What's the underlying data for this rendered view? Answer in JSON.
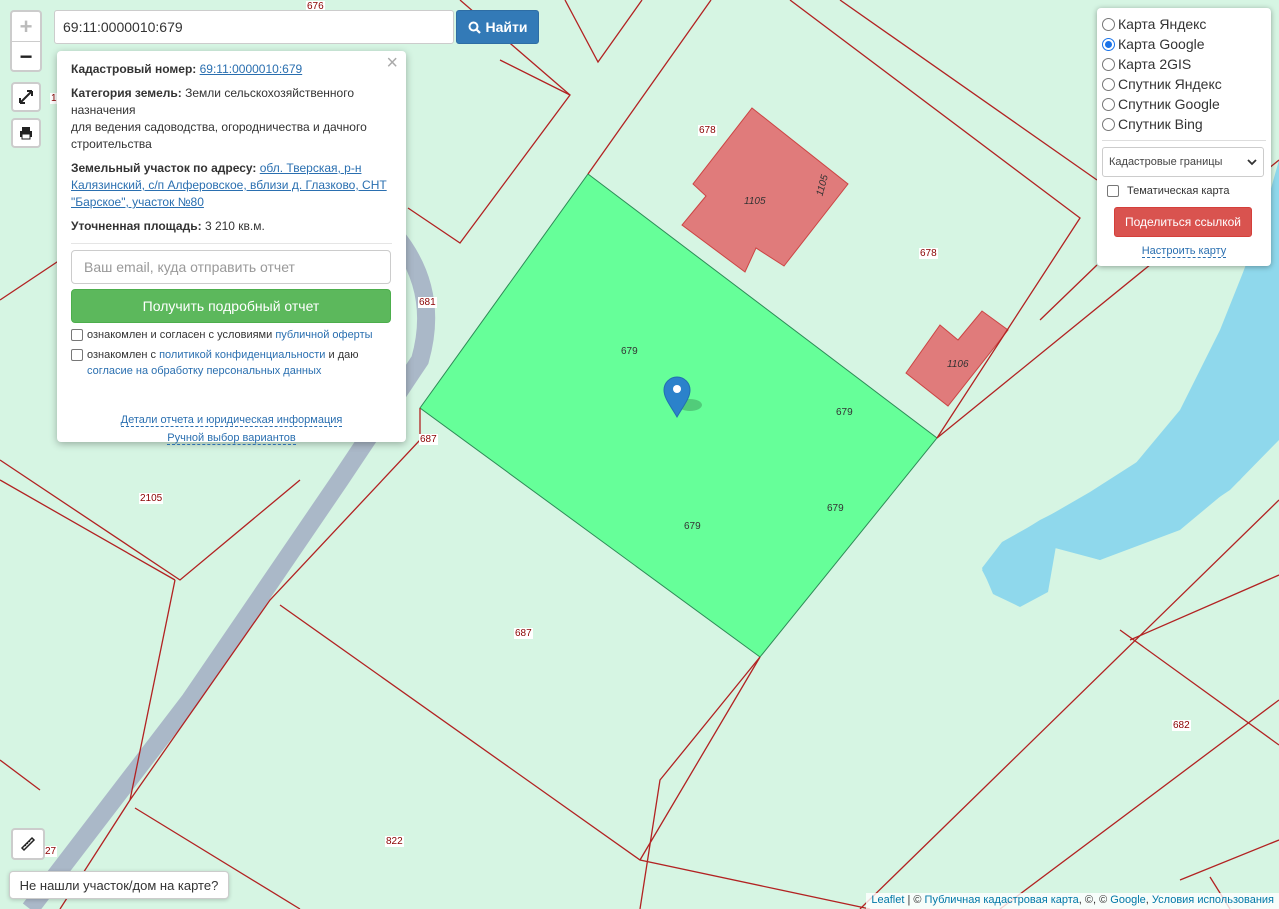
{
  "search": {
    "value": "69:11:0000010:679",
    "button_label": "Найти"
  },
  "zoom": {
    "in": "+",
    "out": "−"
  },
  "popup": {
    "cadastral_label": "Кадастровый номер:",
    "cadastral_value": "69:11:0000010:679",
    "category_label": "Категория земель:",
    "category_value": "Земли сельскохозяйственного назначения",
    "purpose": "для ведения садоводства, огородничества и дачного строительства",
    "address_label": "Земельный участок по адресу:",
    "address_value": "обл. Тверская, р-н Калязинский, с/п Алферовское, вблизи д. Глазково, СНТ \"Барское\", участок №80",
    "area_label": "Уточненная площадь:",
    "area_value": "3 210 кв.м.",
    "email_placeholder": "Ваш email, куда отправить отчет",
    "report_button": "Получить подробный отчет",
    "agree1_text": "ознакомлен и согласен с условиями",
    "agree1_link": "публичной оферты",
    "agree2_text": "ознакомлен с",
    "agree2_link": "политикой конфиденциальности",
    "agree2_tail": "и даю",
    "agree2_link2": "согласие на обработку персональных данных",
    "details_link": "Детали отчета и юридическая информация",
    "manual_link": "Ручной выбор вариантов"
  },
  "layers": {
    "options": [
      {
        "label": "Карта Яндекс",
        "selected": false
      },
      {
        "label": "Карта Google",
        "selected": true
      },
      {
        "label": "Карта 2GIS",
        "selected": false
      },
      {
        "label": "Спутник Яндекс",
        "selected": false
      },
      {
        "label": "Спутник Google",
        "selected": false
      },
      {
        "label": "Спутник Bing",
        "selected": false
      }
    ],
    "select_value": "Кадастровые границы",
    "thematic_label": "Тематическая карта",
    "share_button": "Поделиться ссылкой",
    "setup_link": "Настроить карту"
  },
  "map_labels": {
    "l676": "676",
    "l678a": "678",
    "l678b": "678",
    "l1105a": "1105",
    "l1105b": "1105",
    "l1106": "1106",
    "l681": "681",
    "l687a": "687",
    "l687b": "687",
    "l2105": "2105",
    "l679a": "679",
    "l679b": "679",
    "l679c": "679",
    "l679d": "679",
    "l682": "682",
    "l822": "822",
    "l27": "27",
    "l1": "1"
  },
  "not_found_button": "Не нашли участок/дом на карте?",
  "attribution": {
    "leaflet": "Leaflet",
    "sep": " | © ",
    "pkk": "Публичная кадастровая карта",
    "mid": ", ©, © ",
    "google": "Google",
    "comma": ", ",
    "terms": "Условия использования"
  },
  "colors": {
    "map_bg": "#d6f5e3",
    "parcel_selected": "#66ff99",
    "building": "#e07b7b",
    "water": "#8fd8ec",
    "road": "#aab8c8",
    "boundary": "#b22222"
  }
}
